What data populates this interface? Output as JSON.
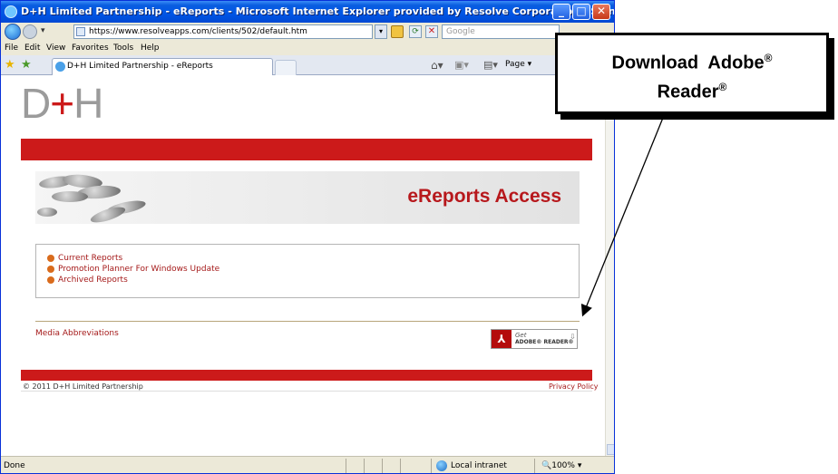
{
  "window": {
    "title": "D+H Limited Partnership - eReports - Microsoft Internet Explorer provided by Resolve Corporation - Saint John"
  },
  "address_bar": {
    "url": "https://www.resolveapps.com/clients/502/default.htm",
    "search_placeholder": "Google"
  },
  "menu": [
    "File",
    "Edit",
    "View",
    "Favorites",
    "Tools",
    "Help"
  ],
  "tab": {
    "label": "D+H Limited Partnership - eReports"
  },
  "command_bar": {
    "page_label": "Page"
  },
  "page": {
    "logo_left": "D",
    "logo_plus": "+",
    "logo_right": "H",
    "banner_title": "eReports Access",
    "links": [
      "Current Reports",
      "Promotion Planner For Windows Update",
      "Archived Reports"
    ],
    "media_link": "Media Abbreviations",
    "adobe_badge": {
      "get": "Get",
      "product": "ADOBE® READER®"
    },
    "copyright": "© 2011 D+H Limited Partnership",
    "privacy": "Privacy Policy"
  },
  "status": {
    "left": "Done",
    "zone": "Local intranet",
    "zoom": "100%"
  },
  "callout": {
    "line1": "Download  Adobe",
    "line2": "Reader",
    "reg": "®"
  },
  "colors": {
    "brand_red": "#cc1a1a",
    "link_red": "#a51a1a",
    "title_blue": "#0055e5"
  }
}
